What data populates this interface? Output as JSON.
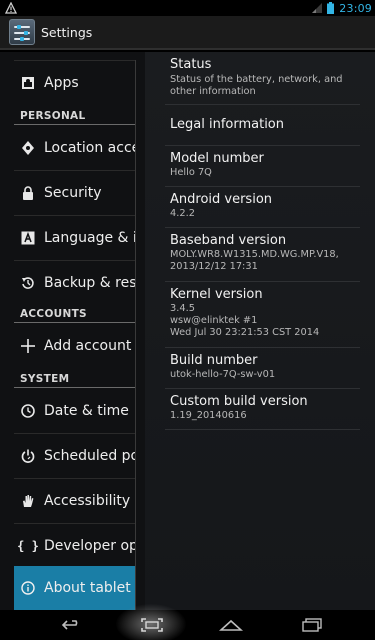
{
  "status_bar": {
    "time": "23:09"
  },
  "action_bar": {
    "title": "Settings"
  },
  "left_nav": {
    "items": [
      {
        "label": "Apps",
        "icon": "android-apps-icon"
      },
      {
        "label": "Location acce",
        "icon": "location-icon"
      },
      {
        "label": "Security",
        "icon": "lock-icon"
      },
      {
        "label": "Language & i",
        "icon": "language-icon"
      },
      {
        "label": "Backup & res",
        "icon": "backup-icon"
      },
      {
        "label": "Add account",
        "icon": "plus-icon"
      },
      {
        "label": "Date & time",
        "icon": "clock-icon"
      },
      {
        "label": "Scheduled po",
        "icon": "power-icon"
      },
      {
        "label": "Accessibility",
        "icon": "hand-icon"
      },
      {
        "label": "Developer op",
        "icon": "braces-icon"
      },
      {
        "label": "About tablet",
        "icon": "info-icon"
      }
    ],
    "headers": {
      "personal": "PERSONAL",
      "accounts": "ACCOUNTS",
      "system": "SYSTEM"
    }
  },
  "about": {
    "status": {
      "title": "Status",
      "subtitle": "Status of the battery, network, and other information"
    },
    "legal": {
      "title": "Legal information"
    },
    "model": {
      "title": "Model number",
      "value": "Hello 7Q"
    },
    "android": {
      "title": "Android version",
      "value": "4.2.2"
    },
    "baseband": {
      "title": "Baseband version",
      "value_line1": "MOLY.WR8.W1315.MD.WG.MP.V18,",
      "value_line2": "2013/12/12 17:31"
    },
    "kernel": {
      "title": "Kernel version",
      "value_line1": "3.4.5",
      "value_line2": "wsw@elinktek #1",
      "value_line3": "Wed Jul 30 23:21:53 CST 2014"
    },
    "build": {
      "title": "Build number",
      "value": "utok-hello-7Q-sw-v01"
    },
    "custom_build": {
      "title": "Custom build version",
      "value": "1.19_20140616"
    }
  },
  "colors": {
    "accent": "#33b5e5",
    "selected": "#1a7ea6"
  }
}
